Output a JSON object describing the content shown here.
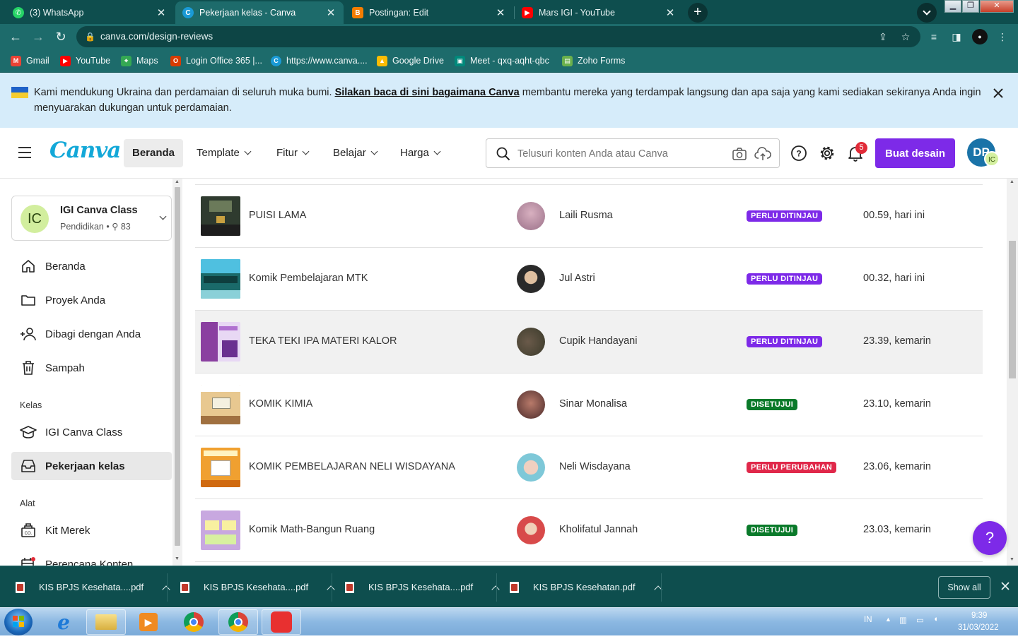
{
  "browser": {
    "tabs": [
      {
        "title": "(3) WhatsApp",
        "icon": "whatsapp-icon",
        "color": "#25d366"
      },
      {
        "title": "Pekerjaan kelas - Canva",
        "icon": "canva-icon",
        "color": "#1a9ad6"
      },
      {
        "title": "Postingan: Edit",
        "icon": "blogger-icon",
        "color": "#f57d00"
      },
      {
        "title": "Mars IGI - YouTube",
        "icon": "youtube-icon",
        "color": "#ff0000"
      }
    ],
    "url": "canva.com/design-reviews",
    "bookmarks": [
      {
        "label": "Gmail",
        "icon": "gmail-icon",
        "color": "#ea4335"
      },
      {
        "label": "YouTube",
        "icon": "youtube-icon",
        "color": "#ff0000"
      },
      {
        "label": "Maps",
        "icon": "maps-icon",
        "color": "#34a853"
      },
      {
        "label": "Login Office 365 |...",
        "icon": "office-icon",
        "color": "#d83b01"
      },
      {
        "label": "https://www.canva....",
        "icon": "canva-icon",
        "color": "#1a9ad6"
      },
      {
        "label": "Google Drive",
        "icon": "drive-icon",
        "color": "#fbbc04"
      },
      {
        "label": "Meet - qxq-aqht-qbc",
        "icon": "meet-icon",
        "color": "#00897b"
      },
      {
        "label": "Zoho Forms",
        "icon": "zoho-icon",
        "color": "#6ab04c"
      }
    ]
  },
  "banner": {
    "text_before": "Kami mendukung Ukraina dan perdamaian di seluruh muka bumi. ",
    "link": "Silakan baca di sini bagaimana Canva",
    "text_after": " membantu mereka yang terdampak langsung dan apa saja yang kami sediakan sekiranya Anda ingin menyuarakan dukungan untuk perdamaian."
  },
  "header": {
    "logo": "Canva",
    "nav": [
      "Beranda",
      "Template",
      "Fitur",
      "Belajar",
      "Harga"
    ],
    "search_placeholder": "Telusuri konten Anda atau Canva",
    "notification_count": "5",
    "create_button": "Buat desain",
    "avatar_initials": "DP",
    "avatar_team": "IC"
  },
  "sidebar": {
    "team": {
      "initials": "IC",
      "name": "IGI Canva Class",
      "category": "Pendidikan",
      "members": "83"
    },
    "main_items": [
      {
        "label": "Beranda",
        "icon": "home-icon"
      },
      {
        "label": "Proyek Anda",
        "icon": "folder-icon"
      },
      {
        "label": "Dibagi dengan Anda",
        "icon": "shared-users-icon"
      },
      {
        "label": "Sampah",
        "icon": "trash-icon"
      }
    ],
    "kelas_heading": "Kelas",
    "kelas_items": [
      {
        "label": "IGI Canva Class",
        "icon": "graduation-cap-icon"
      },
      {
        "label": "Pekerjaan kelas",
        "icon": "inbox-icon"
      }
    ],
    "alat_heading": "Alat",
    "alat_items": [
      {
        "label": "Kit Merek",
        "icon": "brand-kit-icon"
      },
      {
        "label": "Perencana Konten",
        "icon": "calendar-icon"
      }
    ]
  },
  "reviews": {
    "rows": [
      {
        "title": "PUISI LAMA",
        "student": "Laili Rusma",
        "status": "PERLU DITINJAU",
        "status_color": "#7d2ae8",
        "time": "00.59, hari ini",
        "thumb_bg": "#2f3b2f"
      },
      {
        "title": "Komik Pembelajaran MTK",
        "student": "Jul Astri",
        "status": "PERLU DITINJAU",
        "status_color": "#7d2ae8",
        "time": "00.32, hari ini",
        "thumb_bg": "#1a6a6a"
      },
      {
        "title": "TEKA TEKI IPA MATERI KALOR",
        "student": "Cupik Handayani",
        "status": "PERLU DITINJAU",
        "status_color": "#7d2ae8",
        "time": "23.39, kemarin",
        "thumb_bg": "#8a3fa0"
      },
      {
        "title": "KOMIK KIMIA",
        "student": "Sinar Monalisa",
        "status": "DISETUJUI",
        "status_color": "#0a7a2a",
        "time": "23.10, kemarin",
        "thumb_bg": "#e8c890"
      },
      {
        "title": "KOMIK PEMBELAJARAN NELI WISDAYANA",
        "student": "Neli Wisdayana",
        "status": "PERLU PERUBAHAN",
        "status_color": "#e0284a",
        "time": "23.06, kemarin",
        "thumb_bg": "#f0a030"
      },
      {
        "title": "Komik Math-Bangun Ruang",
        "student": "Kholifatul Jannah",
        "status": "DISETUJUI",
        "status_color": "#0a7a2a",
        "time": "23.03, kemarin",
        "thumb_bg": "#c8a8e0"
      }
    ]
  },
  "help_button": "?",
  "downloads": {
    "files": [
      "KIS BPJS Kesehata....pdf",
      "KIS BPJS Kesehata....pdf",
      "KIS BPJS Kesehata....pdf",
      "KIS BPJS Kesehatan.pdf"
    ],
    "show_all": "Show all"
  },
  "taskbar": {
    "lang": "IN",
    "time": "9:39",
    "date": "31/03/2022"
  }
}
